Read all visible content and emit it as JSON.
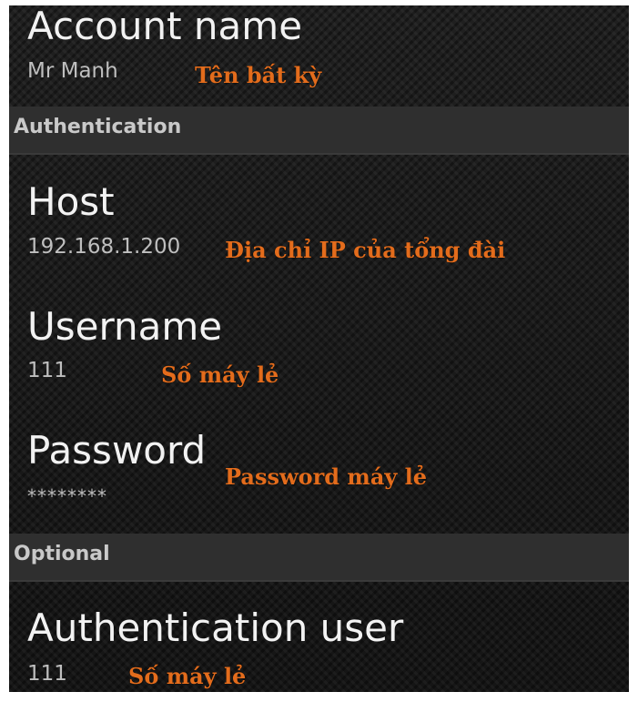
{
  "preferences": {
    "account_name": {
      "title": "Account name",
      "summary": "Mr Manh",
      "note": "Tên bất kỳ"
    },
    "host": {
      "title": "Host",
      "summary": "192.168.1.200",
      "note": "Địa chỉ IP của tổng đài"
    },
    "username": {
      "title": "Username",
      "summary": "111",
      "note": "Số máy lẻ"
    },
    "password": {
      "title": "Password",
      "summary": "********",
      "note": "Password máy lẻ"
    },
    "auth_user": {
      "title": "Authentication user",
      "summary": "111",
      "note": "Số máy lẻ"
    }
  },
  "categories": {
    "authentication": "Authentication",
    "optional": "Optional"
  },
  "colors": {
    "background": "#1c1c1c",
    "category_bg": "#2f2f2f",
    "title_text": "#f2f2f2",
    "summary_text": "#bfbfbf",
    "annotation": "#e36c1c"
  }
}
